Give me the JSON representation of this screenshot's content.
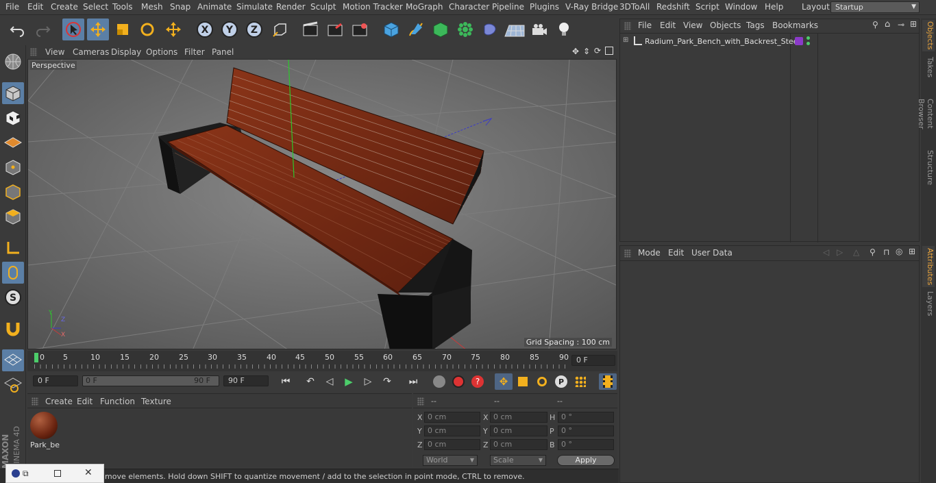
{
  "menubar": {
    "items": [
      "File",
      "Edit",
      "Create",
      "Select",
      "Tools",
      "Mesh",
      "Snap",
      "Animate",
      "Simulate",
      "Render",
      "Sculpt",
      "Motion Tracker",
      "MoGraph",
      "Character",
      "Pipeline",
      "Plugins",
      "V-Ray Bridge",
      "3DToAll",
      "Redshift",
      "Script",
      "Window",
      "Help"
    ],
    "layout_label": "Layout:",
    "layout_value": "Startup"
  },
  "viewport": {
    "menu": [
      "View",
      "Cameras",
      "Display",
      "Options",
      "Filter",
      "Panel"
    ],
    "camera": "Perspective",
    "grid_spacing": "Grid Spacing : 100 cm"
  },
  "timeline": {
    "ticks": [
      "0",
      "5",
      "10",
      "15",
      "20",
      "25",
      "30",
      "35",
      "40",
      "45",
      "50",
      "55",
      "60",
      "65",
      "70",
      "75",
      "80",
      "85",
      "90"
    ],
    "current_frame": "0 F"
  },
  "playback": {
    "start": "0 F",
    "range_start": "0 F",
    "range_end": "90 F",
    "end": "90 F"
  },
  "material": {
    "menu": [
      "Create",
      "Edit",
      "Function",
      "Texture"
    ],
    "name": "Park_be"
  },
  "coords": {
    "headers": [
      "--",
      "--",
      "--"
    ],
    "rows": [
      {
        "l1": "X",
        "v1": "0 cm",
        "l2": "X",
        "v2": "0 cm",
        "l3": "H",
        "v3": "0 °"
      },
      {
        "l1": "Y",
        "v1": "0 cm",
        "l2": "Y",
        "v2": "0 cm",
        "l3": "P",
        "v3": "0 °"
      },
      {
        "l1": "Z",
        "v1": "0 cm",
        "l2": "Z",
        "v2": "0 cm",
        "l3": "B",
        "v3": "0 °"
      }
    ],
    "mode": "World",
    "scale": "Scale",
    "apply": "Apply"
  },
  "status": "move elements. Hold down SHIFT to quantize movement / add to the selection in point mode, CTRL to remove.",
  "objects": {
    "menu": [
      "File",
      "Edit",
      "View",
      "Objects",
      "Tags",
      "Bookmarks"
    ],
    "item": "Radium_Park_Bench_with_Backrest_Steel"
  },
  "attributes": {
    "menu": [
      "Mode",
      "Edit",
      "User Data"
    ]
  },
  "sidetabs": {
    "top": [
      "Objects",
      "Takes",
      "Content Browser",
      "Structure"
    ],
    "bottom": [
      "Attributes",
      "Layers"
    ]
  },
  "brand": {
    "maxon": "MAXON",
    "cinema": "CINEMA 4D"
  },
  "colors": {
    "accent": "#5b7fa6",
    "wood": "#7a2e17",
    "metal": "#1d1d1d",
    "tab_active": "#e8a33c"
  }
}
